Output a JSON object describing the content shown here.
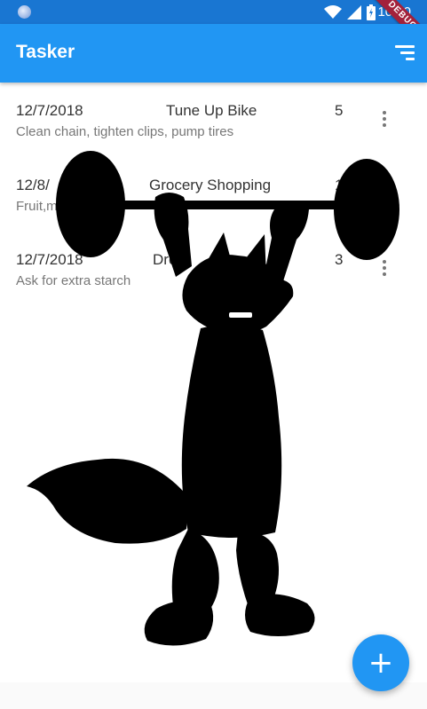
{
  "status_bar": {
    "time": "10:30",
    "icons": [
      "wifi-icon",
      "signal-icon",
      "battery-icon"
    ],
    "debug_banner": "DEBUG"
  },
  "app_bar": {
    "title": "Tasker",
    "sort_icon": "sort-icon"
  },
  "tasks": [
    {
      "date": "12/7/2018",
      "title": "Tune Up Bike",
      "count": "5",
      "description": "Clean chain, tighten clips, pump tires"
    },
    {
      "date": "12/8/",
      "title": "Grocery Shopping",
      "count": "1",
      "description": "Fruit,m"
    },
    {
      "date": "12/7/2018",
      "title": "Dro",
      "count": "3",
      "description": "Ask for extra starch"
    }
  ],
  "fab": {
    "label": "+",
    "icon": "add-icon"
  },
  "colors": {
    "status_bar": "#1976d2",
    "app_bar": "#2196f3",
    "fab": "#2196f3",
    "debug_ribbon": "#a3213b",
    "text_primary": "#333333",
    "text_secondary": "#777777"
  }
}
